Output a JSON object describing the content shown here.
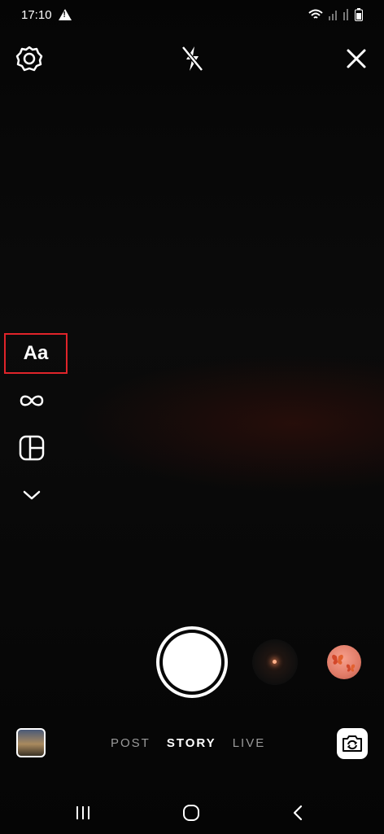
{
  "status_bar": {
    "time": "17:10",
    "icons": [
      "alert-icon",
      "wifi-icon",
      "signal-icon",
      "signal-icon-2",
      "battery-icon"
    ]
  },
  "top_controls": {
    "settings_icon": "gear-icon",
    "flash_icon": "flash-off-icon",
    "close_icon": "close-icon"
  },
  "tools": {
    "text_label": "Aa",
    "boomerang_icon": "infinity-icon",
    "layout_icon": "layout-grid-icon",
    "more_icon": "chevron-down-icon"
  },
  "capture": {
    "shutter_icon": "shutter-button",
    "effect_1": "sparkle-effect",
    "effect_2": "butterfly-effect"
  },
  "modes": {
    "items": [
      "POST",
      "STORY",
      "LIVE"
    ],
    "active": "STORY"
  },
  "accent_color": "#e0242a",
  "navigation": {
    "icons": [
      "recent-apps-icon",
      "home-icon",
      "back-icon"
    ]
  }
}
